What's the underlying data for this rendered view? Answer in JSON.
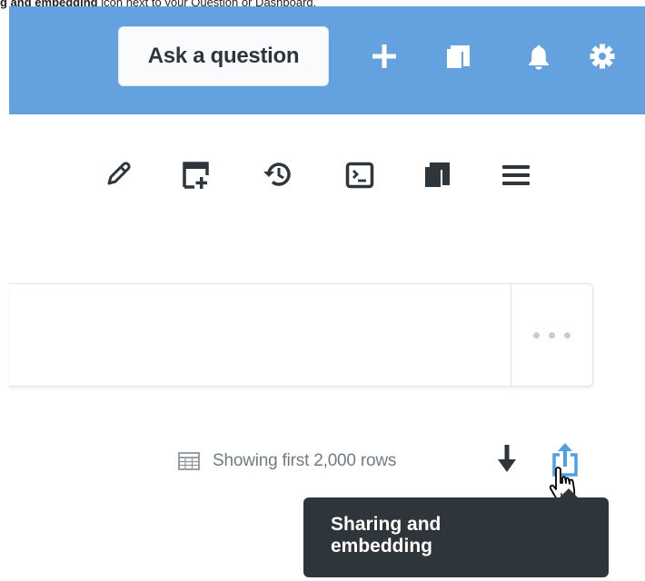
{
  "caption": {
    "bold_text": "g and embedding",
    "rest_text": " icon next to your Question or Dashboard."
  },
  "topbar": {
    "ask_question_label": "Ask a question",
    "icons": [
      "plus-icon",
      "collection-icon",
      "bell-icon",
      "gear-icon"
    ],
    "background_color": "#64a1df"
  },
  "toolbar": {
    "icons": [
      "pencil-icon",
      "add-to-dashboard-icon",
      "history-icon",
      "sql-editor-icon",
      "collection-icon",
      "menu-icon"
    ]
  },
  "query_box": {
    "more_button_icon": "ellipsis-icon"
  },
  "results": {
    "row_count_text": "Showing first 2,000 rows",
    "table_icon": "table-icon",
    "download_icon": "download-icon",
    "share_icon": "share-icon"
  },
  "tooltip": {
    "line1": "Sharing and",
    "line2": "embedding"
  },
  "colors": {
    "accent": "#509ee3",
    "text_dark": "#2e353b",
    "text_muted": "#707b85",
    "tooltip_bg": "#2e353b"
  }
}
